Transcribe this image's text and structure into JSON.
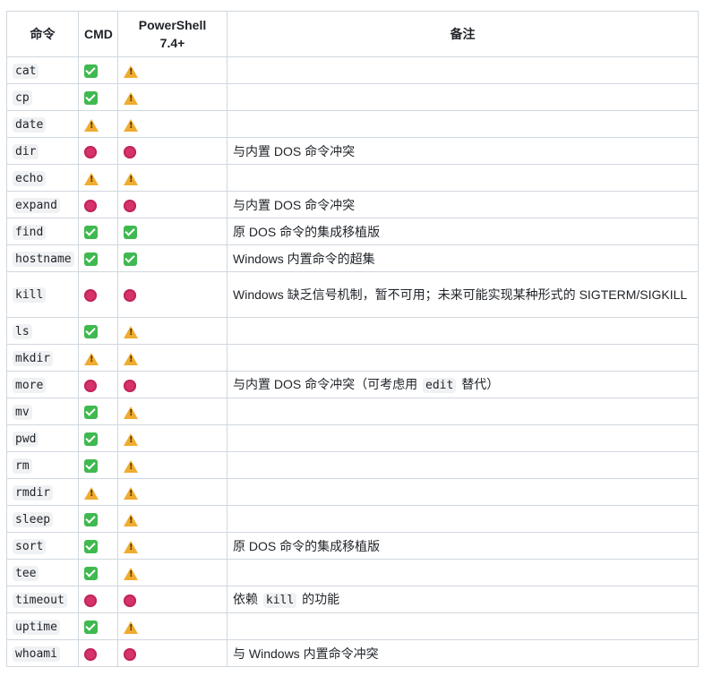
{
  "headers": {
    "command": "命令",
    "cmd": "CMD",
    "powershell_line1": "PowerShell",
    "powershell_line2": "7.4+",
    "notes": "备注"
  },
  "status_legend": {
    "ok": "check-icon",
    "warn": "warning-icon",
    "no": "blocked-icon"
  },
  "rows": [
    {
      "cmd_name": "cat",
      "cmd": "ok",
      "ps": "warn",
      "note": ""
    },
    {
      "cmd_name": "cp",
      "cmd": "ok",
      "ps": "warn",
      "note": ""
    },
    {
      "cmd_name": "date",
      "cmd": "warn",
      "ps": "warn",
      "note": ""
    },
    {
      "cmd_name": "dir",
      "cmd": "no",
      "ps": "no",
      "note": "与内置 DOS 命令冲突"
    },
    {
      "cmd_name": "echo",
      "cmd": "warn",
      "ps": "warn",
      "note": ""
    },
    {
      "cmd_name": "expand",
      "cmd": "no",
      "ps": "no",
      "note": "与内置 DOS 命令冲突"
    },
    {
      "cmd_name": "find",
      "cmd": "ok",
      "ps": "ok",
      "note": "原 DOS 命令的集成移植版"
    },
    {
      "cmd_name": "hostname",
      "cmd": "ok",
      "ps": "ok",
      "note": "Windows 内置命令的超集"
    },
    {
      "cmd_name": "kill",
      "cmd": "no",
      "ps": "no",
      "note": "Windows 缺乏信号机制，暂不可用；未来可能实现某种形式的 SIGTERM/SIGKILL"
    },
    {
      "cmd_name": "ls",
      "cmd": "ok",
      "ps": "warn",
      "note": ""
    },
    {
      "cmd_name": "mkdir",
      "cmd": "warn",
      "ps": "warn",
      "note": ""
    },
    {
      "cmd_name": "more",
      "cmd": "no",
      "ps": "no",
      "note_pre": "与内置 DOS 命令冲突（可考虑用",
      "note_code": "edit",
      "note_post": "替代）"
    },
    {
      "cmd_name": "mv",
      "cmd": "ok",
      "ps": "warn",
      "note": ""
    },
    {
      "cmd_name": "pwd",
      "cmd": "ok",
      "ps": "warn",
      "note": ""
    },
    {
      "cmd_name": "rm",
      "cmd": "ok",
      "ps": "warn",
      "note": ""
    },
    {
      "cmd_name": "rmdir",
      "cmd": "warn",
      "ps": "warn",
      "note": ""
    },
    {
      "cmd_name": "sleep",
      "cmd": "ok",
      "ps": "warn",
      "note": ""
    },
    {
      "cmd_name": "sort",
      "cmd": "ok",
      "ps": "warn",
      "note": "原 DOS 命令的集成移植版"
    },
    {
      "cmd_name": "tee",
      "cmd": "ok",
      "ps": "warn",
      "note": ""
    },
    {
      "cmd_name": "timeout",
      "cmd": "no",
      "ps": "no",
      "note_pre": "依赖",
      "note_code": "kill",
      "note_post": "的功能"
    },
    {
      "cmd_name": "uptime",
      "cmd": "ok",
      "ps": "warn",
      "note": ""
    },
    {
      "cmd_name": "whoami",
      "cmd": "no",
      "ps": "no",
      "note": "与 Windows 内置命令冲突"
    }
  ]
}
